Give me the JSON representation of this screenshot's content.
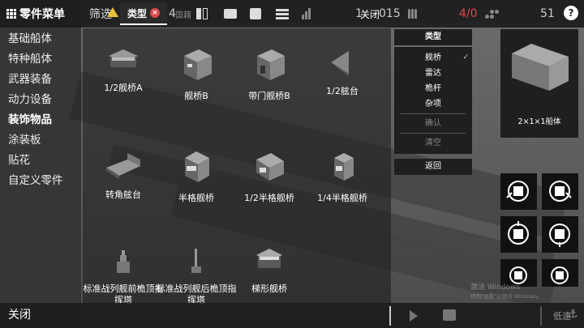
{
  "sidebar": {
    "title": "零件菜单",
    "items": [
      {
        "label": "基础船体",
        "active": false
      },
      {
        "label": "特种船体",
        "active": false
      },
      {
        "label": "武器装备",
        "active": false
      },
      {
        "label": "动力设备",
        "active": false
      },
      {
        "label": "装饰物品",
        "active": true
      },
      {
        "label": "涂装板",
        "active": false
      },
      {
        "label": "贴花",
        "active": false
      },
      {
        "label": "自定义零件",
        "active": false
      }
    ],
    "close_label": "关闭"
  },
  "topbar": {
    "filter_label": "筛选",
    "filter_count": "4",
    "type_chip_label": "类型",
    "type_chip_clear": "×",
    "ghost_label": "国籍",
    "cost_value": "1",
    "cost_value_right": "015",
    "cost_overlay": "关闭",
    "weapon_count": "4/0",
    "weapon_color": "#e04848",
    "crew_count": "51",
    "help_label": "?"
  },
  "parts": [
    {
      "label": "1/2舰桥A",
      "icon": "half-bridge-a-icon"
    },
    {
      "label": "舰桥B",
      "icon": "bridge-b-icon"
    },
    {
      "label": "带门舰桥B",
      "icon": "door-bridge-b-icon"
    },
    {
      "label": "1/2舷台",
      "icon": "half-deck-icon"
    },
    {
      "label": "转角舷台",
      "icon": "corner-deck-icon"
    },
    {
      "label": "半格舰桥",
      "icon": "half-grid-bridge-icon"
    },
    {
      "label": "1/2半格舰桥",
      "icon": "half-half-grid-bridge-icon"
    },
    {
      "label": "1/4半格舰桥",
      "icon": "quarter-half-grid-bridge-icon"
    },
    {
      "label": "",
      "icon": "ship-silhouette-icon"
    },
    {
      "label": "",
      "icon": "mast-silhouette-icon"
    },
    {
      "label": "",
      "icon": "ladder-bridge-icon"
    },
    {
      "label": "标准战列舰前桅顶指挥塔",
      "icon": "fore-mast-tower-icon"
    },
    {
      "label": "标准战列舰后桅顶指挥塔",
      "icon": "rear-mast-tower-icon"
    },
    {
      "label": "梯形舰桥",
      "icon": "trapezoid-bridge-icon"
    }
  ],
  "filter": {
    "header": "类型",
    "options": [
      {
        "label": "舰桥",
        "checked": true
      },
      {
        "label": "雷达",
        "checked": false
      },
      {
        "label": "桅杆",
        "checked": false
      },
      {
        "label": "杂项",
        "checked": false
      }
    ],
    "confirm_label": "确认",
    "clear_label": "清空",
    "back_label": "返回"
  },
  "preview": {
    "label": "2×1×1船体"
  },
  "watermark": {
    "line1": "激活 Windows",
    "line2": "转到\"设置\"以激活 Windows。"
  },
  "bottom": {
    "anchor_label": "低速"
  }
}
